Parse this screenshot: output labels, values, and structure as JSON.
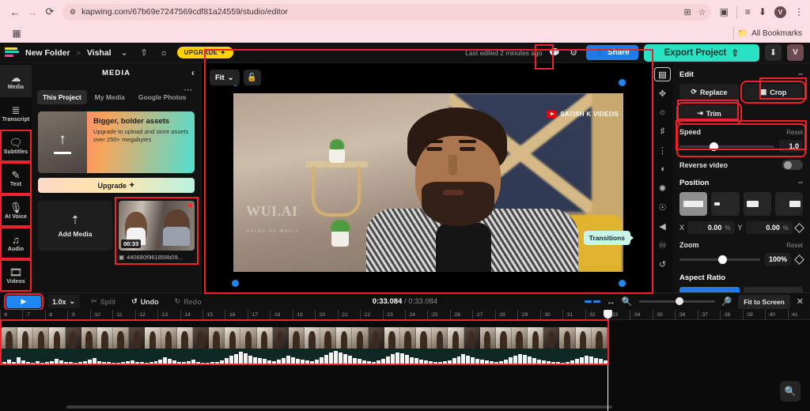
{
  "browser": {
    "url": "kapwing.com/67b69e7247569cdf81a24559/studio/editor",
    "back_icon": "back-arrow-icon",
    "forward_icon": "forward-arrow-icon",
    "reload_icon": "reload-icon",
    "site_info_icon": "site-settings-icon",
    "install_icon": "install-app-icon",
    "bookmark_icon": "star-icon",
    "extensions_icon": "extensions-icon",
    "reading_list_icon": "reading-list-icon",
    "downloads_icon": "downloads-icon",
    "profile_initial": "V",
    "menu_icon": "kebab-menu-icon",
    "bookmarks_label": "All Bookmarks",
    "apps_icon": "apps-grid-icon"
  },
  "header": {
    "folder": "New Folder",
    "separator": ">",
    "project": "Vishal",
    "chevron": "⌄",
    "share_icon": "upload-icon",
    "idea_icon": "lightbulb-icon",
    "upgrade_label": "UPGRADE",
    "last_edited": "Last edited 2 minutes ago",
    "comment_icon": "comment-icon",
    "settings_icon": "gear-icon",
    "share_label": "Share",
    "export_label": "Export Project",
    "download_icon": "download-icon",
    "avatar_initial": "V"
  },
  "rail": {
    "items": [
      {
        "label": "Media",
        "icon": "cloud-upload-icon",
        "active": true,
        "highlighted": false
      },
      {
        "label": "Transcript",
        "icon": "transcript-icon",
        "active": false,
        "highlighted": false
      },
      {
        "label": "Subtitles",
        "icon": "subtitles-icon",
        "active": false,
        "highlighted": true
      },
      {
        "label": "Text",
        "icon": "text-icon",
        "active": false,
        "highlighted": true
      },
      {
        "label": "AI Voice",
        "icon": "microphone-icon",
        "active": false,
        "highlighted": true
      },
      {
        "label": "Audio",
        "icon": "music-note-icon",
        "active": false,
        "highlighted": true
      },
      {
        "label": "Videos",
        "icon": "film-icon",
        "active": false,
        "highlighted": true
      }
    ]
  },
  "media_panel": {
    "title": "MEDIA",
    "collapse_icon": "chevron-left-icon",
    "more_icon": "more-options-icon",
    "tabs": [
      {
        "label": "This Project",
        "active": true
      },
      {
        "label": "My Media",
        "active": false
      },
      {
        "label": "Google Photos",
        "active": false
      }
    ],
    "promo": {
      "heading": "Bigger, bolder assets",
      "body": "Upgrade to upload and store assets over 250+ megabytes",
      "cta": "Upgrade",
      "cta_icon": "sparkle-icon"
    },
    "add_media_label": "Add Media",
    "add_media_icon": "upload-icon",
    "asset": {
      "duration": "00:33",
      "filename": "440680f961859b09...",
      "file_icon": "video-file-icon"
    }
  },
  "preview": {
    "fit_label": "Fit",
    "fit_chevron": "⌄",
    "lock_icon": "unlock-icon",
    "channel_badge": "SATISH K VIDEOS",
    "watermark": "WUI.AI",
    "watermark_sub": "RULES OF MAGIC",
    "transitions_tooltip": "Transitions"
  },
  "tool_strip": {
    "items": [
      {
        "icon": "film-icon",
        "boxed": true
      },
      {
        "icon": "move-icon",
        "boxed": false
      },
      {
        "icon": "brightness-icon",
        "boxed": false
      },
      {
        "icon": "audio-note-icon",
        "boxed": false
      },
      {
        "icon": "adjust-sliders-icon",
        "boxed": false
      },
      {
        "icon": "mask-icon",
        "boxed": false
      },
      {
        "icon": "effects-icon",
        "boxed": false
      },
      {
        "icon": "animation-icon",
        "boxed": false
      },
      {
        "icon": "transitions-icon",
        "boxed": false
      },
      {
        "icon": "shapes-icon",
        "boxed": false
      },
      {
        "icon": "history-icon",
        "boxed": false
      }
    ]
  },
  "edit_panel": {
    "section_title": "Edit",
    "collapse_icon": "minimize-icon",
    "replace_label": "Replace",
    "replace_icon": "replace-icon",
    "crop_label": "Crop",
    "crop_icon": "crop-icon",
    "trim_label": "Trim",
    "trim_icon": "trim-icon",
    "speed_label": "Speed",
    "speed_reset": "Reset",
    "speed_value": "1.0",
    "reverse_label": "Reverse video",
    "position_title": "Position",
    "x_label": "X",
    "x_value": "0.00",
    "x_unit": "%",
    "y_label": "Y",
    "y_value": "0.00",
    "y_unit": "%",
    "keyframe_icon": "keyframe-diamond-icon",
    "zoom_label": "Zoom",
    "zoom_reset": "Reset",
    "zoom_value": "100",
    "zoom_unit": "%",
    "aspect_title": "Aspect Ratio"
  },
  "timeline": {
    "play_icon": "play-icon",
    "speed_value": "1.0x",
    "speed_chevron": "⌄",
    "split_label": "Split",
    "split_icon": "scissors-icon",
    "undo_label": "Undo",
    "undo_icon": "undo-arrow-icon",
    "redo_label": "Redo",
    "redo_icon": "redo-arrow-icon",
    "current_time": "0:33.084",
    "time_separator": " / ",
    "total_time": "0:33.084",
    "markers_icon": "track-markers-icon",
    "fit_width_icon": "fit-width-icon",
    "zoom_out_icon": "zoom-out-icon",
    "zoom_in_icon": "zoom-in-icon",
    "fit_screen_label": "Fit to Screen",
    "close_icon": "close-icon",
    "ruler_ticks": [
      ":6",
      ":7",
      ":8",
      ":9",
      ":10",
      ":11",
      ":12",
      ":13",
      ":14",
      ":15",
      ":16",
      ":17",
      ":18",
      ":19",
      ":20",
      ":21",
      ":22",
      ":23",
      ":24",
      ":25",
      ":26",
      ":27",
      ":28",
      ":29",
      ":30",
      ":31",
      ":32",
      ":33",
      ":34",
      ":35",
      ":36",
      ":37",
      ":38",
      ":39",
      ":40",
      ":41"
    ],
    "playhead_tick": ":33",
    "search_icon": "search-icon"
  },
  "colors": {
    "accent_blue": "#1e88f0",
    "export_teal": "#27e3c4",
    "upgrade_yellow": "#ffd300",
    "annotation_red": "#f0212b",
    "browser_pink": "#fbdfe4"
  }
}
